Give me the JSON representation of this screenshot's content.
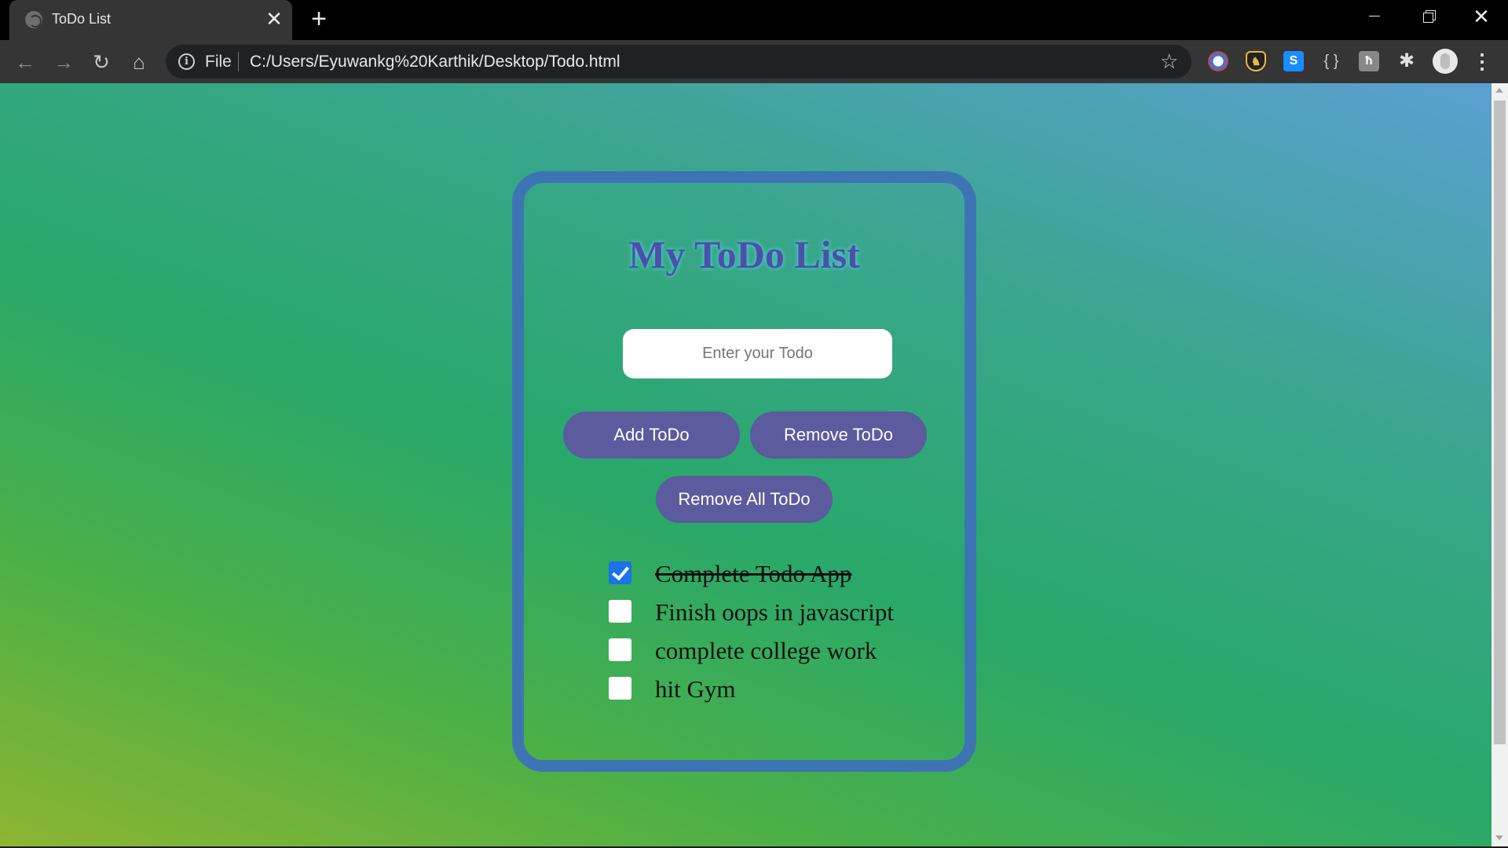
{
  "browser": {
    "tab_title": "ToDo List",
    "tab_close": "✕",
    "new_tab": "+",
    "window_close": "✕",
    "scheme_label": "File",
    "url": "C:/Users/Eyuwankg%20Karthik/Desktop/Todo.html",
    "nav": {
      "back": "←",
      "forward": "→",
      "reload": "↻",
      "home": "⌂"
    },
    "star": "☆",
    "menu": "⋮",
    "extensions": [
      {
        "name": "extension-1-icon",
        "glyph": ""
      },
      {
        "name": "extension-2-icon",
        "glyph": "♞"
      },
      {
        "name": "extension-3-icon",
        "glyph": "S"
      },
      {
        "name": "extension-4-icon",
        "glyph": "{ }"
      },
      {
        "name": "extension-5-icon",
        "glyph": "ħ"
      },
      {
        "name": "extensions-puzzle-icon",
        "glyph": "✱"
      }
    ]
  },
  "app": {
    "title": "My ToDo List",
    "input": {
      "placeholder": "Enter your Todo",
      "value": ""
    },
    "buttons": {
      "add": "Add ToDo",
      "remove": "Remove ToDo",
      "remove_all": "Remove All ToDo"
    },
    "todos": [
      {
        "text": "Complete Todo App",
        "done": true
      },
      {
        "text": "Finish oops in javascript",
        "done": false
      },
      {
        "text": "complete college work",
        "done": false
      },
      {
        "text": "hit Gym",
        "done": false
      }
    ]
  },
  "colors": {
    "card_border": "#3d75b4",
    "title": "#4d4fad",
    "button_bg": "#5b5b9e",
    "checkbox_checked": "#1a73e8"
  }
}
